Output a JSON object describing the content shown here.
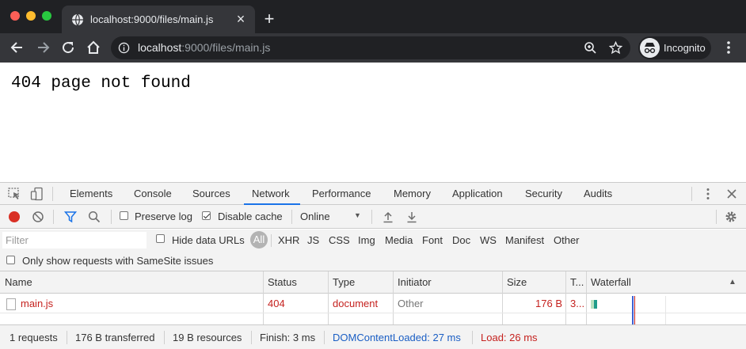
{
  "browser": {
    "tab_title": "localhost:9000/files/main.js",
    "url_host": "localhost",
    "url_rest": ":9000/files/main.js",
    "profile_label": "Incognito"
  },
  "page": {
    "message": "404 page not found"
  },
  "devtools": {
    "tabs": [
      "Elements",
      "Console",
      "Sources",
      "Network",
      "Performance",
      "Memory",
      "Application",
      "Security",
      "Audits"
    ],
    "active_tab": "Network",
    "accent_color": "#1a73e8",
    "network_toolbar": {
      "preserve_log_label": "Preserve log",
      "preserve_log_checked": false,
      "disable_cache_label": "Disable cache",
      "disable_cache_checked": true,
      "throttling_value": "Online"
    },
    "filter": {
      "placeholder": "Filter",
      "hide_data_urls_label": "Hide data URLs",
      "types": [
        "All",
        "XHR",
        "JS",
        "CSS",
        "Img",
        "Media",
        "Font",
        "Doc",
        "WS",
        "Manifest",
        "Other"
      ],
      "active_type": "All",
      "samesite_label": "Only show requests with SameSite issues"
    },
    "columns": [
      "Name",
      "Status",
      "Type",
      "Initiator",
      "Size",
      "T...",
      "Waterfall"
    ],
    "requests": [
      {
        "name": "main.js",
        "status": "404",
        "type": "document",
        "initiator": "Other",
        "size": "176 B",
        "time": "3..."
      }
    ],
    "summary": {
      "requests": "1 requests",
      "transferred": "176 B transferred",
      "resources": "19 B resources",
      "finish": "Finish: 3 ms",
      "dom_content_loaded": "DOMContentLoaded: 27 ms",
      "load": "Load: 26 ms"
    },
    "error_color": "#c5221f"
  }
}
